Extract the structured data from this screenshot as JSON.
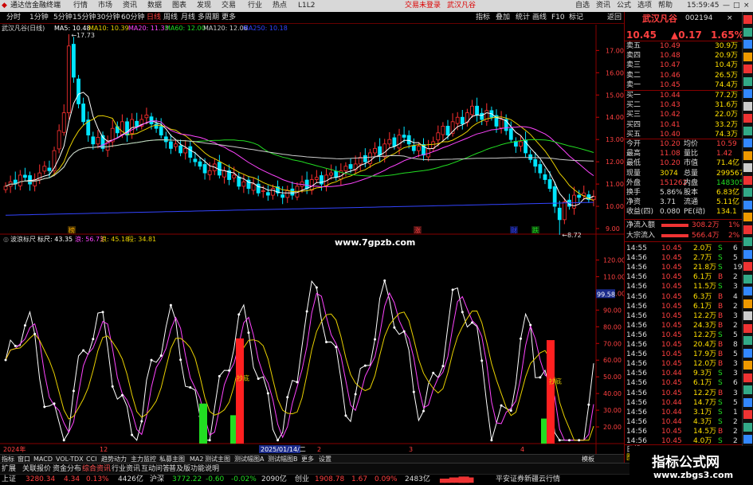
{
  "app": {
    "title": "通达信金融终端",
    "menus": [
      "行情",
      "市场",
      "资讯",
      "数据",
      "图表",
      "发现",
      "交易",
      "行业",
      "热点",
      "L1L2"
    ],
    "alerts": [
      "交易未登录",
      "武汉凡谷"
    ],
    "tools": [
      "自选",
      "资讯",
      "公式",
      "选项",
      "帮助"
    ],
    "clock": "15:59:45"
  },
  "periods": [
    "分时",
    "1分钟",
    "5分钟",
    "15分钟",
    "30分钟",
    "60分钟",
    "日线",
    "周线",
    "月线",
    "多周期",
    "更多"
  ],
  "toolbar": [
    "指标",
    "叠加",
    "统计",
    "画线",
    "F10",
    "标记",
    "返回"
  ],
  "chart": {
    "title": "武汉凡谷(日线)",
    "ma": [
      {
        "label": "MA5: 10.48",
        "color": "#ffffff"
      },
      {
        "label": "MA10: 10.39",
        "color": "#e8d000"
      },
      {
        "label": "MA20: 11.33",
        "color": "#ff44ff"
      },
      {
        "label": "MA60: 12.00",
        "color": "#22dd22"
      },
      {
        "label": "MA120: 12.06",
        "color": "#cccccc"
      },
      {
        "label": "MA250: 10.18",
        "color": "#3344ff"
      }
    ],
    "high_label": "17.73",
    "low_label": "8.72",
    "tags": [
      "榜",
      "涨",
      "财",
      "跌"
    ],
    "price_axis": [
      "17.00",
      "16.00",
      "15.00",
      "14.00",
      "13.00",
      "12.00",
      "11.00",
      "10.00",
      "9.00"
    ],
    "indicator": {
      "name": "波浪标尺",
      "items": [
        {
          "label": "标尺: 43.35",
          "color": "#ffffff"
        },
        {
          "label": "浪: 56.73",
          "color": "#ff44ff"
        },
        {
          "label": "浪: 45.18",
          "color": "#e8d000"
        },
        {
          "label": "段: 34.81",
          "color": "#e8d000"
        }
      ]
    },
    "ind_axis": [
      "120.00",
      "110.00",
      "100.00",
      "90.00",
      "80.00",
      "70.00",
      "60.00",
      "50.00",
      "40.00",
      "30.00",
      "20.00"
    ],
    "ind_current": "99.58",
    "signal1": "抄底",
    "signal2": "抄底",
    "dates": [
      "2024年",
      "12",
      "2025/01/14/二",
      "2",
      "3",
      "4"
    ]
  },
  "chart_data": {
    "type": "candlestick",
    "title": "武汉凡谷(日线)",
    "ylim": [
      8.5,
      17.8
    ],
    "high": 17.73,
    "low": 8.72,
    "close": [
      10.9,
      11.1,
      11.0,
      11.4,
      11.3,
      11.0,
      11.2,
      11.5,
      11.8,
      11.6,
      12.5,
      13.4,
      14.2,
      17.2,
      15.8,
      14.6,
      13.8,
      13.2,
      12.8,
      13.1,
      12.6,
      12.9,
      13.5,
      13.3,
      13.8,
      13.2,
      13.9,
      13.6,
      13.9,
      14.1,
      13.7,
      13.5,
      13.2,
      12.9,
      12.6,
      12.8,
      12.4,
      12.6,
      12.2,
      12.0,
      11.8,
      11.5,
      11.6,
      11.9,
      11.4,
      11.6,
      11.2,
      11.4,
      10.9,
      11.1,
      10.8,
      11.0,
      10.6,
      10.7,
      10.5,
      10.8,
      10.6,
      10.4,
      10.7,
      10.5,
      10.9,
      11.1,
      10.8,
      11.2,
      11.3,
      11.0,
      11.4,
      11.5,
      11.3,
      11.6,
      11.8,
      11.7,
      11.9,
      12.2,
      12.0,
      12.4,
      12.6,
      12.3,
      12.8,
      13.0,
      12.7,
      13.2,
      13.1,
      12.8,
      12.5,
      12.7,
      12.3,
      12.6,
      12.9,
      13.3,
      13.6,
      13.2,
      13.8,
      14.0,
      13.7,
      14.2,
      14.5,
      14.1,
      13.9,
      14.3,
      14.0,
      13.6,
      13.9,
      13.4,
      13.0,
      12.7,
      12.9,
      12.4,
      12.1,
      11.8,
      11.5,
      11.2,
      10.8,
      10.0,
      9.4,
      10.2,
      10.0,
      10.5,
      10.4,
      10.6,
      10.3,
      10.45
    ]
  },
  "quote": {
    "name": "武汉凡谷",
    "code": "002194",
    "price": "10.45",
    "change": "▲0.17",
    "pct": "1.65%",
    "asks": [
      [
        "卖五",
        "10.49",
        "30.9万"
      ],
      [
        "卖四",
        "10.48",
        "20.9万"
      ],
      [
        "卖三",
        "10.47",
        "10.4万"
      ],
      [
        "卖二",
        "10.46",
        "26.5万"
      ],
      [
        "卖一",
        "10.45",
        "74.4万"
      ]
    ],
    "bids": [
      [
        "买一",
        "10.44",
        "77.2万"
      ],
      [
        "买二",
        "10.43",
        "31.6万"
      ],
      [
        "买三",
        "10.42",
        "22.0万"
      ],
      [
        "买四",
        "10.41",
        "33.2万"
      ],
      [
        "买五",
        "10.40",
        "74.3万"
      ]
    ],
    "stats": [
      [
        "今开",
        "10.20",
        "均价",
        "10.59"
      ],
      [
        "最高",
        "11.08",
        "量比",
        "1.42"
      ],
      [
        "最低",
        "10.20",
        "市值",
        "71.4亿"
      ],
      [
        "现量",
        "3074",
        "总量",
        "299567"
      ],
      [
        "外盘",
        "151262",
        "内盘",
        "148305"
      ],
      [
        "换手",
        "5.86%",
        "股本",
        "6.83亿"
      ],
      [
        "净资",
        "3.71",
        "流通",
        "5.11亿"
      ],
      [
        "收益(四)",
        "0.080",
        "PE(动)",
        "134.1"
      ]
    ],
    "flow": [
      [
        "净流入额",
        "308.2万",
        "1%"
      ],
      [
        "大宗流入",
        "566.4万",
        "2%"
      ]
    ],
    "ticks": [
      [
        "14:55",
        "10.45",
        "2.0万",
        "S",
        "6"
      ],
      [
        "14:56",
        "10.45",
        "2.7万",
        "S",
        "5"
      ],
      [
        "14:56",
        "10.45",
        "21.8万",
        "S",
        "19"
      ],
      [
        "14:56",
        "10.45",
        "6.1万",
        "B",
        "2"
      ],
      [
        "14:56",
        "10.45",
        "11.5万",
        "S",
        "3"
      ],
      [
        "14:56",
        "10.45",
        "6.3万",
        "B",
        "4"
      ],
      [
        "14:56",
        "10.45",
        "6.1万",
        "B",
        "2"
      ],
      [
        "14:56",
        "10.45",
        "12.2万",
        "B",
        "3"
      ],
      [
        "14:56",
        "10.45",
        "24.3万",
        "B",
        "2"
      ],
      [
        "14:56",
        "10.45",
        "12.2万",
        "S",
        "5"
      ],
      [
        "14:56",
        "10.45",
        "20.4万",
        "B",
        "8"
      ],
      [
        "14:56",
        "10.45",
        "17.9万",
        "B",
        "5"
      ],
      [
        "14:56",
        "10.45",
        "12.0万",
        "B",
        "3"
      ],
      [
        "14:56",
        "10.44",
        "9.3万",
        "S",
        "3"
      ],
      [
        "14:56",
        "10.45",
        "6.1万",
        "S",
        "6"
      ],
      [
        "14:56",
        "10.45",
        "12.2万",
        "B",
        "3"
      ],
      [
        "14:56",
        "10.44",
        "14.7万",
        "S",
        "5"
      ],
      [
        "14:56",
        "10.44",
        "3.1万",
        "S",
        "1"
      ],
      [
        "14:56",
        "10.44",
        "4.3万",
        "S",
        "2"
      ],
      [
        "14:56",
        "10.45",
        "14.5万",
        "B",
        "2"
      ],
      [
        "14:56",
        "10.45",
        "4.0万",
        "S",
        "2"
      ]
    ],
    "tabs": [
      "日线",
      "图数F10",
      "逐笔",
      "分笔",
      "成交"
    ]
  },
  "bottom_tabs": [
    "指标",
    "窗口",
    "MACD",
    "VOL-TDX",
    "CCI",
    "趋势动力",
    "主力监控",
    "私募主图",
    "MA2",
    "测试主图",
    "测试幅图A",
    "测试幅图B",
    "更多",
    "设置",
    "模板"
  ],
  "bottom_tabs2": [
    "扩展",
    "关联报价",
    "资金分布",
    "综合资讯",
    "行业资讯",
    "互动问答",
    "普及版功能说明"
  ],
  "status": [
    {
      "label": "上证",
      "value": "3280.34",
      "chg": "4.34",
      "pct": "0.13%",
      "vol": "4426亿"
    },
    {
      "label": "沪深",
      "value": "3772.22",
      "chg": "-0.60",
      "pct": "-0.02%",
      "vol": "2090亿"
    },
    {
      "label": "创业",
      "value": "1908.78",
      "chg": "1.67",
      "pct": "0.09%",
      "vol": "2483亿"
    }
  ],
  "broker": "平安证券新疆云行情",
  "watermark": "www.7gpzb.com",
  "logo": {
    "title": "指标公式网",
    "url": "www.zbgs3.com"
  }
}
